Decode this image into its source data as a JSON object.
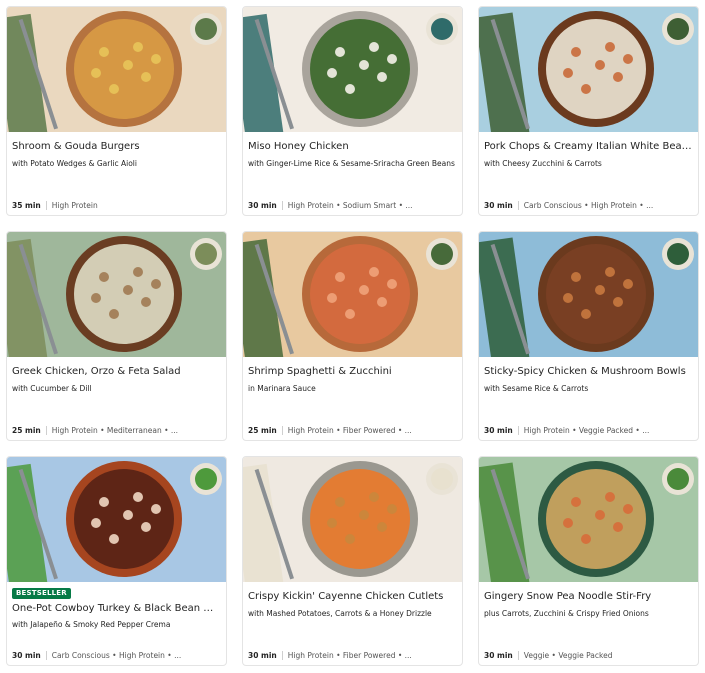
{
  "recipes": [
    {
      "title": "Shroom & Gouda Burgers",
      "subtitle": "with Potato Wedges & Garlic Aioli",
      "time": "35 min",
      "tags": "High Protein",
      "badge": "",
      "colors": {
        "bg": "#ead8bf",
        "plate": "#b5733f",
        "food": "#d89a44",
        "accent": "#5c7a4a",
        "garnish": "#e8c45a"
      }
    },
    {
      "title": "Miso Honey Chicken",
      "subtitle": "with Ginger-Lime Rice & Sesame-Sriracha Green Beans",
      "time": "30 min",
      "tags": "High Protein • Sodium Smart • ...",
      "badge": "",
      "colors": {
        "bg": "#f1ebe3",
        "plate": "#a9a49c",
        "food": "#3f6b2f",
        "accent": "#2f6b6a",
        "garnish": "#f4f1e9"
      }
    },
    {
      "title": "Pork Chops & Creamy Italian White Beans",
      "subtitle": "with Cheesy Zucchini & Carrots",
      "time": "30 min",
      "tags": "Carb Conscious • High Protein • ...",
      "badge": "",
      "colors": {
        "bg": "#a9cfe0",
        "plate": "#6b3a1e",
        "food": "#e6dccb",
        "accent": "#3e5f34",
        "garnish": "#c96a3a"
      }
    },
    {
      "title": "Greek Chicken, Orzo & Feta Salad",
      "subtitle": "with Cucumber & Dill",
      "time": "25 min",
      "tags": "High Protein • Mediterranean • ...",
      "badge": "",
      "colors": {
        "bg": "#9fb79b",
        "plate": "#6a3d22",
        "food": "#d9d5be",
        "accent": "#7c8d5a",
        "garnish": "#a07a52"
      }
    },
    {
      "title": "Shrimp Spaghetti & Zucchini",
      "subtitle": "in Marinara Sauce",
      "time": "25 min",
      "tags": "High Protein • Fiber Powered • ...",
      "badge": "",
      "colors": {
        "bg": "#e8c9a0",
        "plate": "#b7693a",
        "food": "#d46a3e",
        "accent": "#476a3a",
        "garnish": "#efa37a"
      }
    },
    {
      "title": "Sticky-Spicy Chicken & Mushroom Bowls",
      "subtitle": "with Sesame Rice & Carrots",
      "time": "30 min",
      "tags": "High Protein • Veggie Packed • ...",
      "badge": "",
      "colors": {
        "bg": "#8ebcd8",
        "plate": "#6b3a1e",
        "food": "#7a3f24",
        "accent": "#2e5e3a",
        "garnish": "#c8793f"
      }
    },
    {
      "title": "One-Pot Cowboy Turkey & Black Bean Chili",
      "subtitle": "with Jalapeño & Smoky Red Pepper Crema",
      "time": "30 min",
      "tags": "Carb Conscious • High Protein • ...",
      "badge": "BESTSELLER",
      "colors": {
        "bg": "#a8c7e4",
        "plate": "#a6451f",
        "food": "#5a2416",
        "accent": "#4e9a3c",
        "garnish": "#f0d7c2"
      }
    },
    {
      "title": "Crispy Kickin' Cayenne Chicken Cutlets",
      "subtitle": "with Mashed Potatoes, Carrots & a Honey Drizzle",
      "time": "30 min",
      "tags": "High Protein • Fiber Powered • ...",
      "badge": "",
      "colors": {
        "bg": "#efe9e1",
        "plate": "#9a9890",
        "food": "#e77a2e",
        "accent": "#e8e1cf",
        "garnish": "#c9873c"
      }
    },
    {
      "title": "Gingery Snow Pea Noodle Stir-Fry",
      "subtitle": "plus Carrots, Zucchini & Crispy Fried Onions",
      "time": "30 min",
      "tags": "Veggie • Veggie Packed",
      "badge": "",
      "colors": {
        "bg": "#a6c7a7",
        "plate": "#2d5a43",
        "food": "#c8a35f",
        "accent": "#4a8a3a",
        "garnish": "#d76b3a"
      }
    }
  ]
}
